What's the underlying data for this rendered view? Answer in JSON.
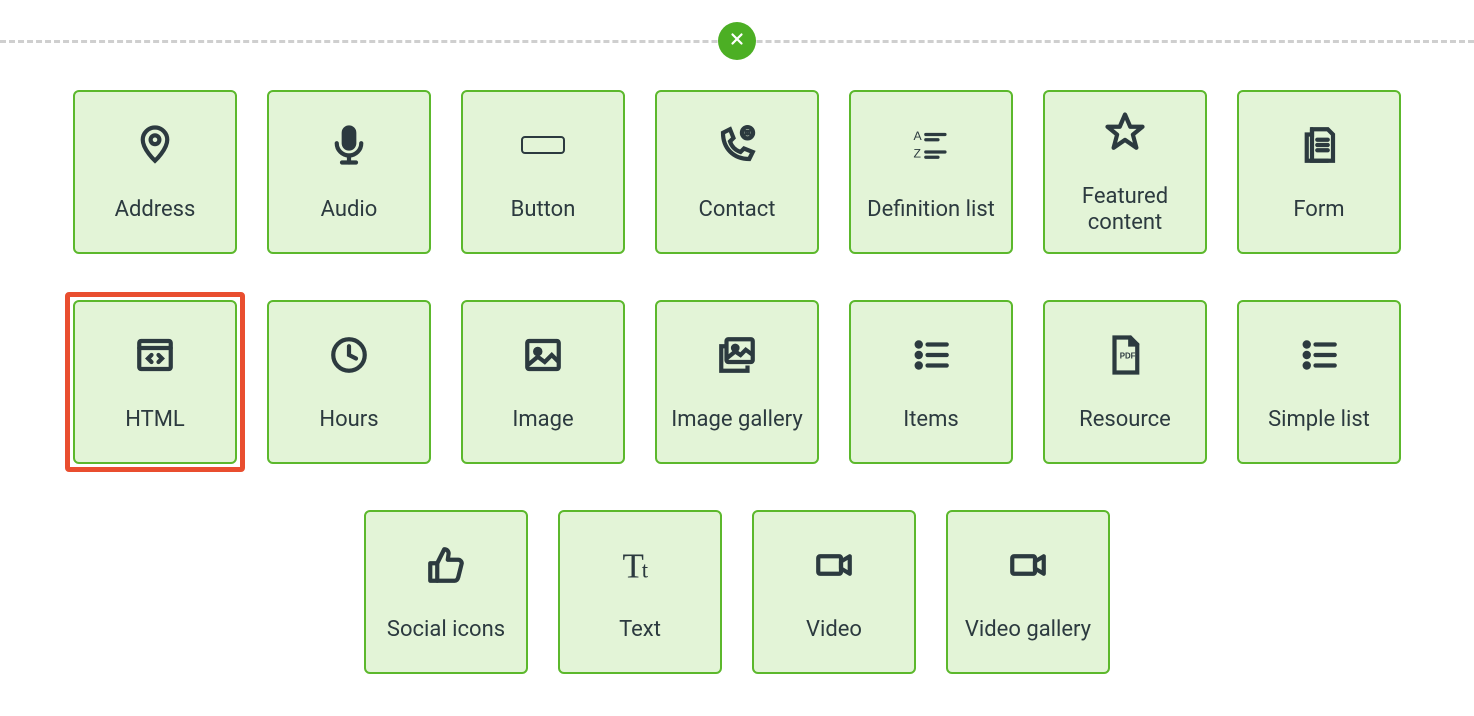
{
  "tiles": [
    [
      {
        "key": "address",
        "label": "Address",
        "icon": "pin",
        "highlight": false
      },
      {
        "key": "audio",
        "label": "Audio",
        "icon": "mic",
        "highlight": false
      },
      {
        "key": "button",
        "label": "Button",
        "icon": "button-shape",
        "highlight": false
      },
      {
        "key": "contact",
        "label": "Contact",
        "icon": "phone-chat",
        "highlight": false
      },
      {
        "key": "definition-list",
        "label": "Definition list",
        "icon": "az-list",
        "highlight": false
      },
      {
        "key": "featured-content",
        "label": "Featured content",
        "icon": "star",
        "highlight": false
      },
      {
        "key": "form",
        "label": "Form",
        "icon": "form-doc",
        "highlight": false
      }
    ],
    [
      {
        "key": "html",
        "label": "HTML",
        "icon": "code-window",
        "highlight": true
      },
      {
        "key": "hours",
        "label": "Hours",
        "icon": "clock",
        "highlight": false
      },
      {
        "key": "image",
        "label": "Image",
        "icon": "image",
        "highlight": false
      },
      {
        "key": "image-gallery",
        "label": "Image gallery",
        "icon": "image-stack",
        "highlight": false
      },
      {
        "key": "items",
        "label": "Items",
        "icon": "bullet-list",
        "highlight": false
      },
      {
        "key": "resource",
        "label": "Resource",
        "icon": "pdf-doc",
        "highlight": false
      },
      {
        "key": "simple-list",
        "label": "Simple list",
        "icon": "bullet-list",
        "highlight": false
      }
    ],
    [
      {
        "key": "social-icons",
        "label": "Social icons",
        "icon": "thumbs-up",
        "highlight": false
      },
      {
        "key": "text",
        "label": "Text",
        "icon": "tt",
        "highlight": false
      },
      {
        "key": "video",
        "label": "Video",
        "icon": "video-cam",
        "highlight": false
      },
      {
        "key": "video-gallery",
        "label": "Video gallery",
        "icon": "video-cam",
        "highlight": false
      }
    ]
  ]
}
